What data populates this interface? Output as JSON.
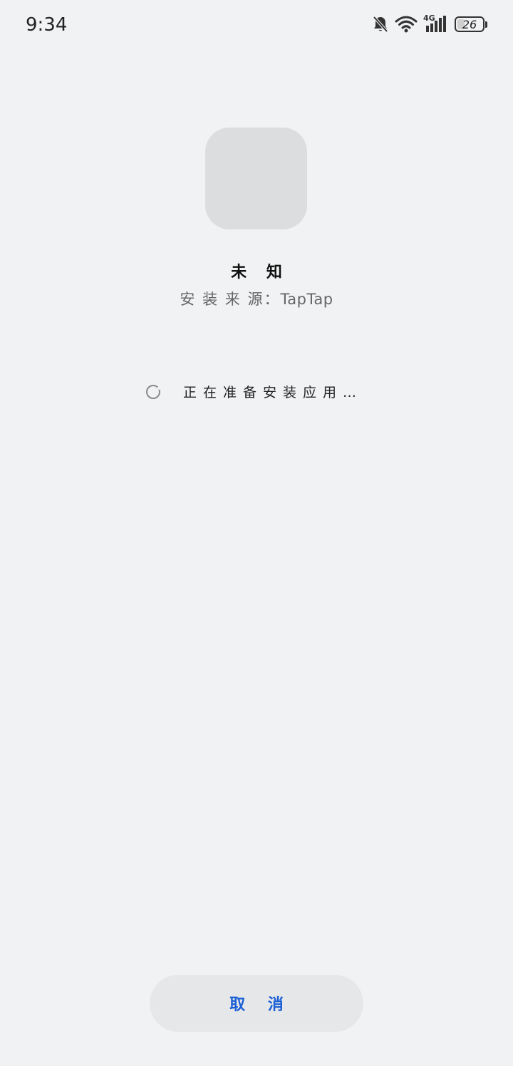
{
  "status_bar": {
    "time": "9:34",
    "network_label": "4G",
    "battery_level": "26",
    "icons": [
      "bell-off-icon",
      "wifi-icon",
      "cellular-signal-icon",
      "battery-icon"
    ]
  },
  "app": {
    "name": "未 知",
    "source_label": "安 装 来 源：",
    "source_value": "TapTap"
  },
  "progress": {
    "status_text": "正在准备安装应用…"
  },
  "actions": {
    "cancel_label": "取 消"
  },
  "colors": {
    "background": "#f1f2f4",
    "accent": "#1a5fd4",
    "button_background": "#e6e7e9",
    "icon_placeholder": "#dcdddf"
  }
}
